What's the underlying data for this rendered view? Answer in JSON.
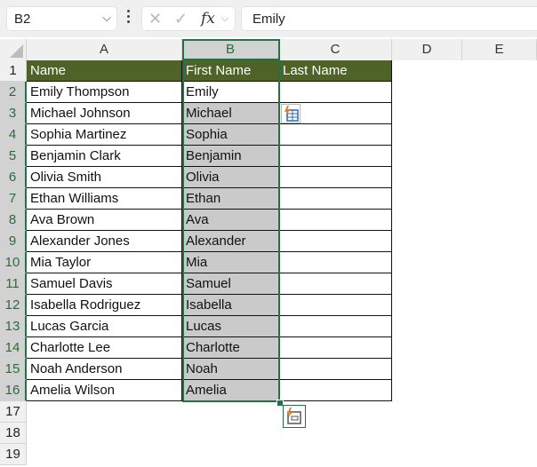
{
  "formula_bar": {
    "name_box": "B2",
    "cancel_icon": "✕",
    "enter_icon": "✓",
    "fx_label": "fx",
    "formula_value": "Emily"
  },
  "columns": [
    "A",
    "B",
    "C",
    "D",
    "E"
  ],
  "selected_column": "B",
  "rows": [
    "1",
    "2",
    "3",
    "4",
    "5",
    "6",
    "7",
    "8",
    "9",
    "10",
    "11",
    "12",
    "13",
    "14",
    "15",
    "16",
    "17",
    "18",
    "19"
  ],
  "header_row": {
    "name": "Name",
    "first_name": "First Name",
    "last_name": "Last Name"
  },
  "data": [
    {
      "name": "Emily Thompson",
      "first": "Emily"
    },
    {
      "name": "Michael Johnson",
      "first": "Michael"
    },
    {
      "name": "Sophia Martinez",
      "first": "Sophia"
    },
    {
      "name": "Benjamin Clark",
      "first": "Benjamin"
    },
    {
      "name": "Olivia Smith",
      "first": "Olivia"
    },
    {
      "name": "Ethan Williams",
      "first": "Ethan"
    },
    {
      "name": "Ava Brown",
      "first": "Ava"
    },
    {
      "name": "Alexander Jones",
      "first": "Alexander"
    },
    {
      "name": "Mia Taylor",
      "first": "Mia"
    },
    {
      "name": "Samuel Davis",
      "first": "Samuel"
    },
    {
      "name": "Isabella Rodriguez",
      "first": "Isabella"
    },
    {
      "name": "Lucas Garcia",
      "first": "Lucas"
    },
    {
      "name": "Charlotte Lee",
      "first": "Charlotte"
    },
    {
      "name": "Noah Anderson",
      "first": "Noah"
    },
    {
      "name": "Amelia Wilson",
      "first": "Amelia"
    }
  ],
  "colors": {
    "header_fill": "#4f6228",
    "selection": "#217346",
    "flash_fill_highlight": "#cacaca"
  }
}
